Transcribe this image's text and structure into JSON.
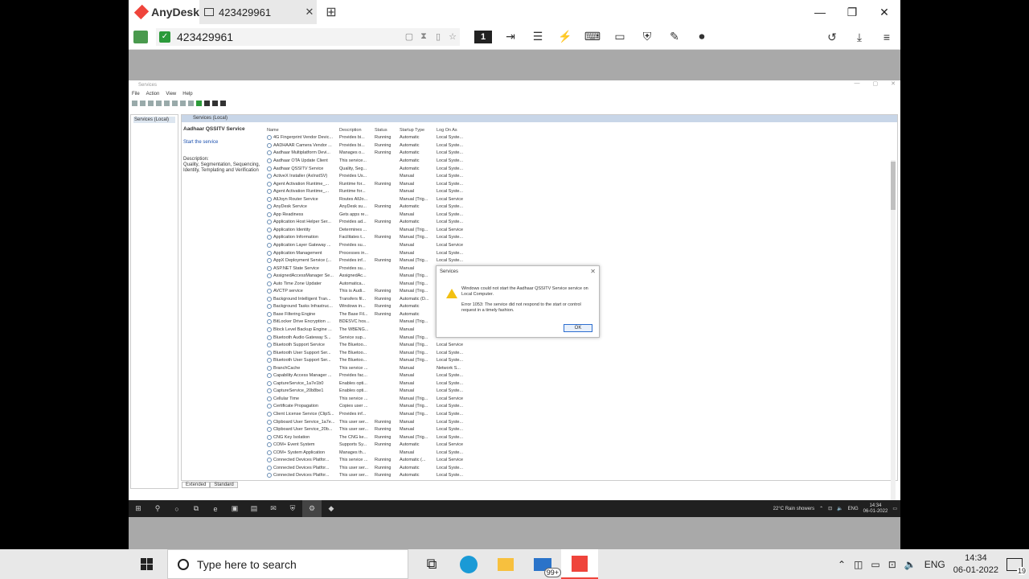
{
  "anydesk": {
    "brand": "AnyDesk",
    "tab_label": "423429961",
    "address": "423429961",
    "session_number": "1"
  },
  "mmc": {
    "window_title": "Services",
    "menu": [
      "File",
      "Action",
      "View",
      "Help"
    ],
    "tree_node": "Services (Local)",
    "header": "Services (Local)",
    "selected_title": "Aadhaar QSSITV Service",
    "start_link": "Start the service",
    "description_label": "Description:",
    "description_text": "Quality, Segmentation, Sequencing, Identity, Templating and Verification",
    "columns": [
      "Name",
      "Description",
      "Status",
      "Startup Type",
      "Log On As"
    ],
    "tabs": [
      "Extended",
      "Standard"
    ],
    "rows": [
      [
        "4G Fingerprint Vendor Devic...",
        "Provides bi...",
        "Running",
        "Automatic",
        "Local Syste..."
      ],
      [
        "AADHAAR Camera Vendor ...",
        "Provides bi...",
        "Running",
        "Automatic",
        "Local Syste..."
      ],
      [
        "Aadhaar Multiplatform Devi...",
        "Manages o...",
        "Running",
        "Automatic",
        "Local Syste..."
      ],
      [
        "Aadhaar OTA Update Client",
        "This service...",
        "",
        "Automatic",
        "Local Syste..."
      ],
      [
        "Aadhaar QSSITV Service",
        "Quality, Seg...",
        "",
        "Automatic",
        "Local Syste..."
      ],
      [
        "ActiveX Installer (AxInstSV)",
        "Provides Us...",
        "",
        "Manual",
        "Local Syste..."
      ],
      [
        "Agent Activation Runtime_...",
        "Runtime for...",
        "Running",
        "Manual",
        "Local Syste..."
      ],
      [
        "Agent Activation Runtime_...",
        "Runtime for...",
        "",
        "Manual",
        "Local Syste..."
      ],
      [
        "AllJoyn Router Service",
        "Routes AllJo...",
        "",
        "Manual (Trig...",
        "Local Service"
      ],
      [
        "AnyDesk Service",
        "AnyDesk su...",
        "Running",
        "Automatic",
        "Local Syste..."
      ],
      [
        "App Readiness",
        "Gets apps re...",
        "",
        "Manual",
        "Local Syste..."
      ],
      [
        "Application Host Helper Ser...",
        "Provides ad...",
        "Running",
        "Automatic",
        "Local Syste..."
      ],
      [
        "Application Identity",
        "Determines ...",
        "",
        "Manual (Trig...",
        "Local Service"
      ],
      [
        "Application Information",
        "Facilitates t...",
        "Running",
        "Manual (Trig...",
        "Local Syste..."
      ],
      [
        "Application Layer Gateway ...",
        "Provides su...",
        "",
        "Manual",
        "Local Service"
      ],
      [
        "Application Management",
        "Processes in...",
        "",
        "Manual",
        "Local Syste..."
      ],
      [
        "AppX Deployment Service (...",
        "Provides inf...",
        "Running",
        "Manual (Trig...",
        "Local Syste..."
      ],
      [
        "ASP.NET State Service",
        "Provides su...",
        "",
        "Manual",
        ""
      ],
      [
        "AssignedAccessManager Se...",
        "AssignedAc...",
        "",
        "Manual (Trig...",
        ""
      ],
      [
        "Auto Time Zone Updater",
        "Automatica...",
        "",
        "Manual (Trig...",
        ""
      ],
      [
        "AVCTP service",
        "This is Audi...",
        "Running",
        "Manual (Trig...",
        ""
      ],
      [
        "Background Intelligent Tran...",
        "Transfers fil...",
        "Running",
        "Automatic (D...",
        ""
      ],
      [
        "Background Tasks Infrastruc...",
        "Windows in...",
        "Running",
        "Automatic",
        ""
      ],
      [
        "Base Filtering Engine",
        "The Base Fil...",
        "Running",
        "Automatic",
        ""
      ],
      [
        "BitLocker Drive Encryption ...",
        "BDESVC hos...",
        "",
        "Manual (Trig...",
        ""
      ],
      [
        "Block Level Backup Engine ...",
        "The WBENG...",
        "",
        "Manual",
        ""
      ],
      [
        "Bluetooth Audio Gateway S...",
        "Service sup...",
        "",
        "Manual (Trig...",
        ""
      ],
      [
        "Bluetooth Support Service",
        "The Bluetoo...",
        "",
        "Manual (Trig...",
        "Local Service"
      ],
      [
        "Bluetooth User Support Ser...",
        "The Bluetoo...",
        "",
        "Manual (Trig...",
        "Local Syste..."
      ],
      [
        "Bluetooth User Support Ser...",
        "The Bluetoo...",
        "",
        "Manual (Trig...",
        "Local Syste..."
      ],
      [
        "BranchCache",
        "This service ...",
        "",
        "Manual",
        "Network S..."
      ],
      [
        "Capability Access Manager ...",
        "Provides fac...",
        "",
        "Manual",
        "Local Syste..."
      ],
      [
        "CaptureService_1a7e1b0",
        "Enables opti...",
        "",
        "Manual",
        "Local Syste..."
      ],
      [
        "CaptureService_20b8be1",
        "Enables opti...",
        "",
        "Manual",
        "Local Syste..."
      ],
      [
        "Cellular Time",
        "This service ...",
        "",
        "Manual (Trig...",
        "Local Service"
      ],
      [
        "Certificate Propagation",
        "Copies user ...",
        "",
        "Manual (Trig...",
        "Local Syste..."
      ],
      [
        "Client License Service (ClipS...",
        "Provides inf...",
        "",
        "Manual (Trig...",
        "Local Syste..."
      ],
      [
        "Clipboard User Service_1a7e...",
        "This user ser...",
        "Running",
        "Manual",
        "Local Syste..."
      ],
      [
        "Clipboard User Service_20b...",
        "This user ser...",
        "Running",
        "Manual",
        "Local Syste..."
      ],
      [
        "CNG Key Isolation",
        "The CNG ke...",
        "Running",
        "Manual (Trig...",
        "Local Syste..."
      ],
      [
        "COM+ Event System",
        "Supports Sy...",
        "Running",
        "Automatic",
        "Local Service"
      ],
      [
        "COM+ System Application",
        "Manages th...",
        "",
        "Manual",
        "Local Syste..."
      ],
      [
        "Connected Devices Platfor...",
        "This service ...",
        "Running",
        "Automatic (...",
        "Local Service"
      ],
      [
        "Connected Devices Platfor...",
        "This user ser...",
        "Running",
        "Automatic",
        "Local Syste..."
      ],
      [
        "Connected Devices Platfor...",
        "This user ser...",
        "Running",
        "Automatic",
        "Local Syste..."
      ]
    ]
  },
  "dialog": {
    "title": "Services",
    "message": "Windows could not start the Aadhaar QSSITV Service service on Local Computer.",
    "error": "Error 1053: The service did not respond to the start or control request in a timely fashion.",
    "ok_label": "OK"
  },
  "remote_taskbar": {
    "weather": "22°C  Rain showers",
    "lang": "ENG",
    "time": "14:34",
    "date": "06-01-2022"
  },
  "local_taskbar": {
    "search_placeholder": "Type here to search",
    "mail_badge": "99+",
    "lang": "ENG",
    "time": "14:34",
    "date": "06-01-2022",
    "notification_count": "19"
  }
}
